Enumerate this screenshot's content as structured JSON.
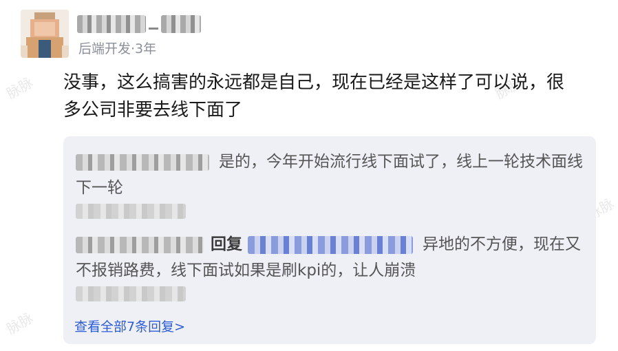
{
  "watermark_text": "脉脉",
  "author": {
    "meta": "后端开发·3年"
  },
  "post": {
    "text": "没事，这么搞害的永远都是自己，现在已经是这样了可以说，很多公司非要去线下面了"
  },
  "replies": [
    {
      "text": "是的，今年开始流行线下面试了，线上一轮技术面线下一轮"
    },
    {
      "reply_word": "回复",
      "text": "异地的不方便，现在又不报销路费，线下面试如果是刷kpi的，让人崩溃"
    }
  ],
  "see_all": "查看全部7条回复>"
}
